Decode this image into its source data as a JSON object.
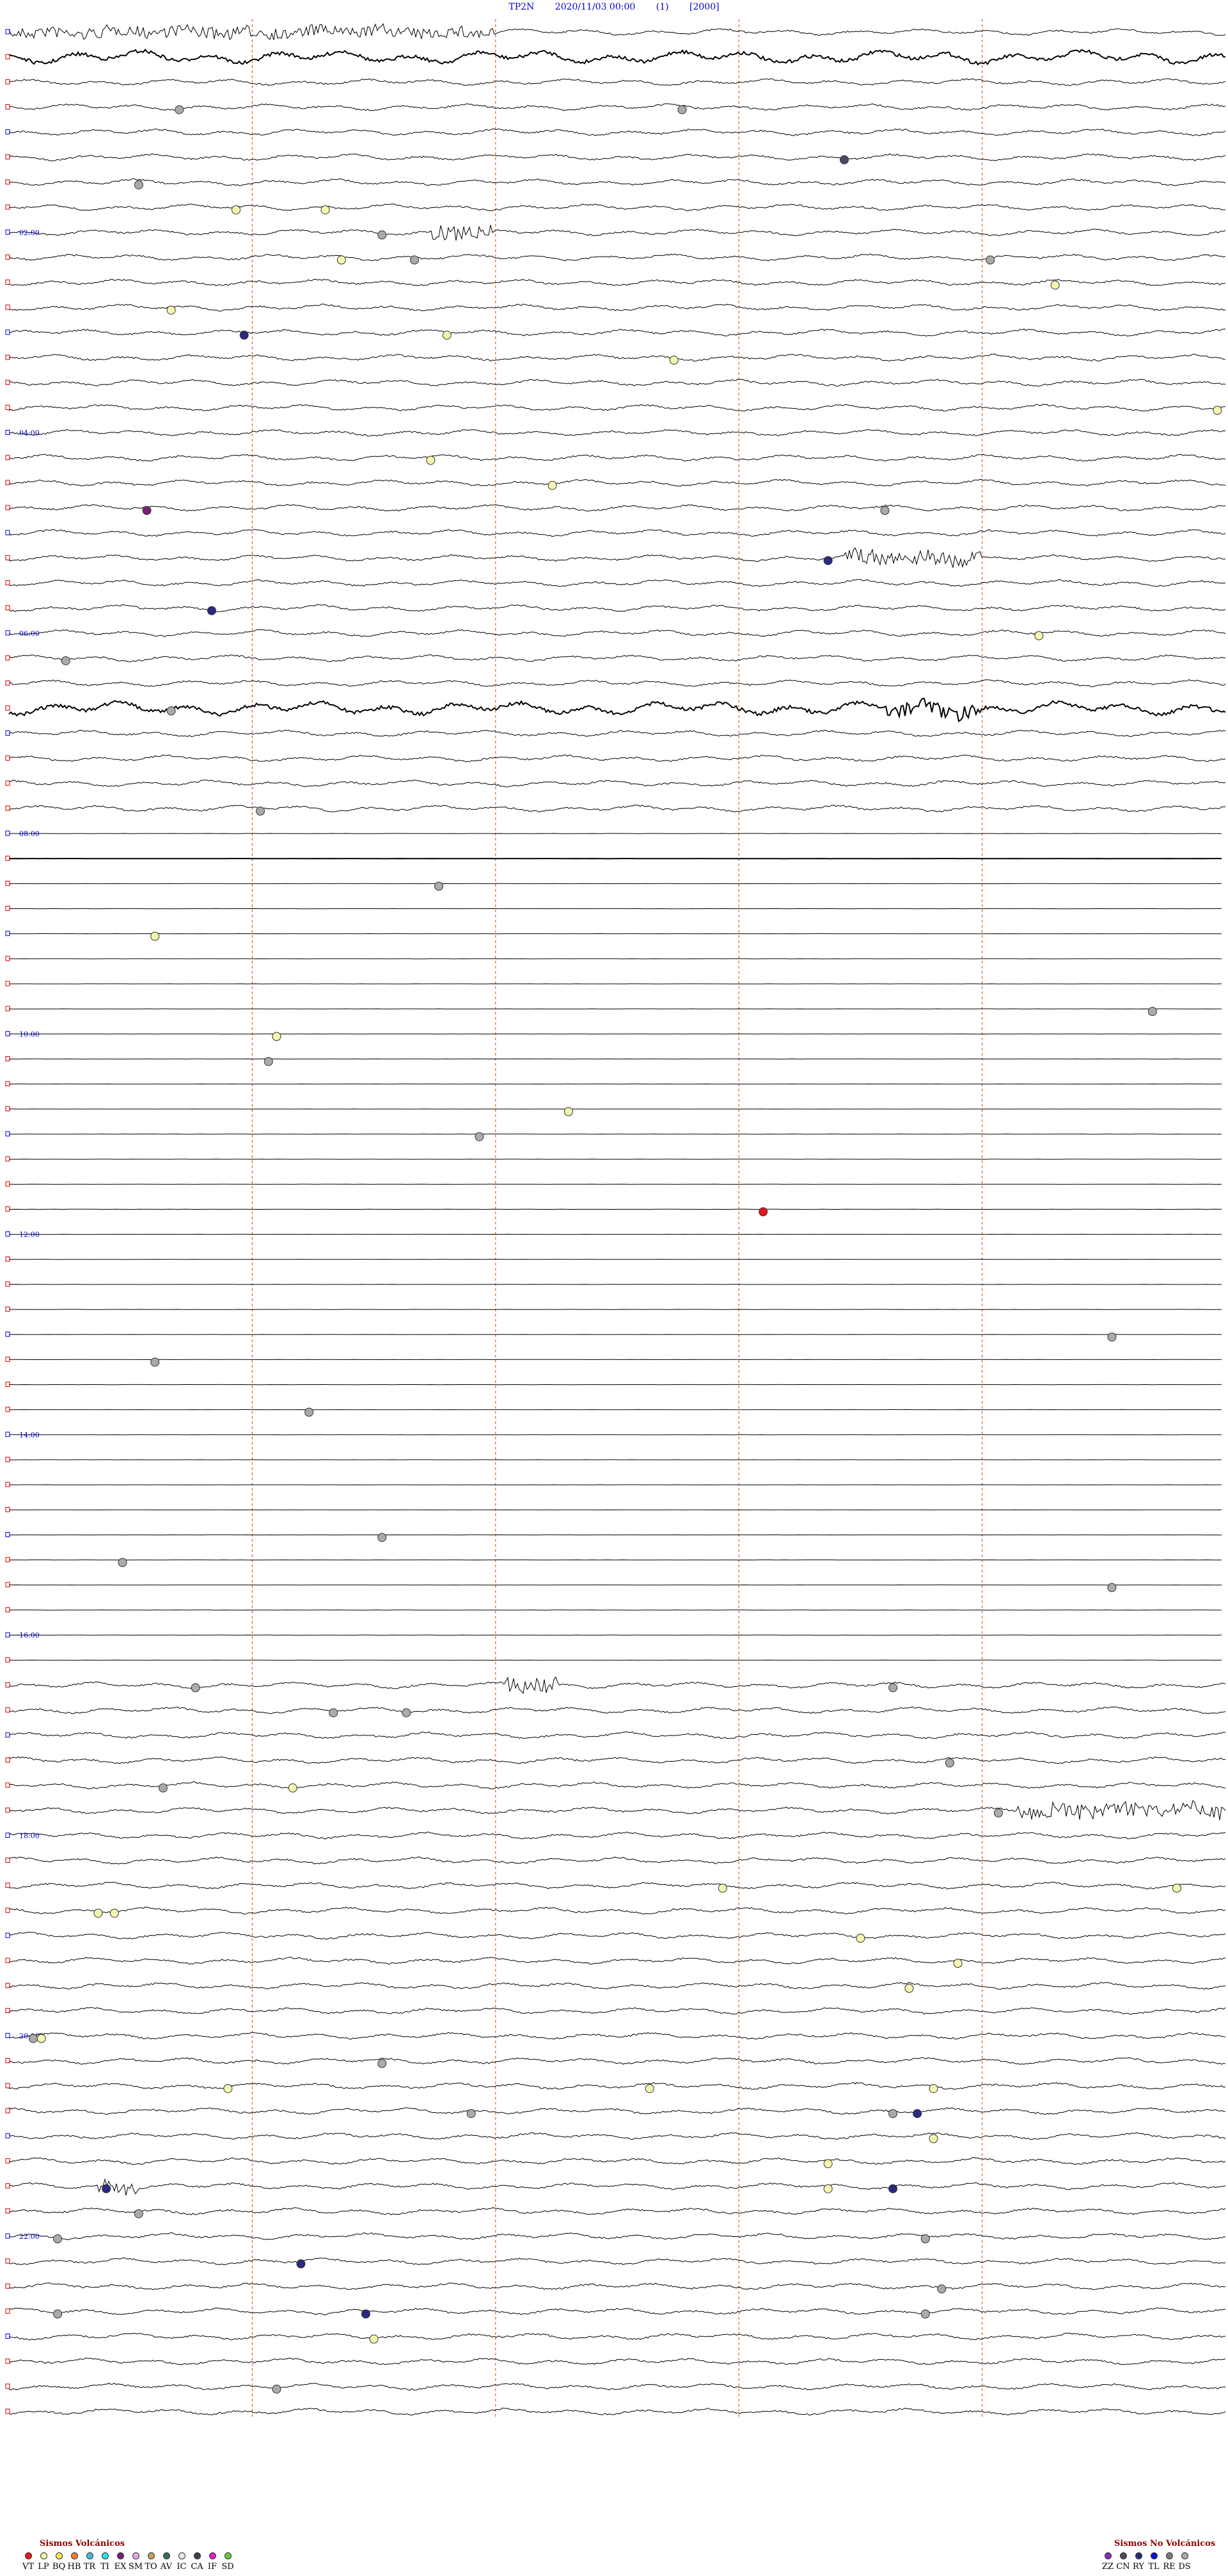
{
  "header": {
    "station": "TP2N",
    "datetime": "2020/11/03 00:00",
    "channel": "(1)",
    "scale": "[2000]"
  },
  "chart_data": {
    "type": "helicorder",
    "rows": 96,
    "row_minutes": 15,
    "time_labels": [
      "02:00",
      "04:00",
      "06:00",
      "08:00",
      "10:00",
      "12:00",
      "14:00",
      "16:00",
      "18:00",
      "20:00",
      "22:00"
    ],
    "minute_marks": [
      3,
      6,
      9,
      12
    ],
    "noisy_row_ranges": [
      [
        0,
        32
      ],
      [
        66,
        96
      ]
    ],
    "high_amplitude_rows": [
      1,
      27,
      33
    ],
    "bursts": [
      {
        "row": 0,
        "from_min": 0.0,
        "to_min": 6.0,
        "type": "dense"
      },
      {
        "row": 8,
        "from_min": 5.2,
        "to_min": 6.0,
        "type": "event"
      },
      {
        "row": 21,
        "from_min": 10.3,
        "to_min": 12.0,
        "type": "event"
      },
      {
        "row": 27,
        "from_min": 10.8,
        "to_min": 12.0,
        "type": "event"
      },
      {
        "row": 66,
        "from_min": 6.1,
        "to_min": 6.8,
        "type": "event"
      },
      {
        "row": 71,
        "from_min": 12.4,
        "to_min": 15.0,
        "type": "event"
      },
      {
        "row": 86,
        "from_min": 1.1,
        "to_min": 1.6,
        "type": "event"
      }
    ],
    "events": [
      {
        "row": 3,
        "minute": 2.1,
        "type": "DS"
      },
      {
        "row": 3,
        "minute": 8.3,
        "type": "DS"
      },
      {
        "row": 5,
        "minute": 10.3,
        "type": "CN"
      },
      {
        "row": 6,
        "minute": 1.6,
        "type": "DS"
      },
      {
        "row": 7,
        "minute": 2.8,
        "type": "LP"
      },
      {
        "row": 7,
        "minute": 3.9,
        "type": "LP"
      },
      {
        "row": 8,
        "minute": 4.6,
        "type": "DS"
      },
      {
        "row": 9,
        "minute": 5.0,
        "type": "DS"
      },
      {
        "row": 9,
        "minute": 12.1,
        "type": "DS"
      },
      {
        "row": 9,
        "minute": 4.1,
        "type": "LP"
      },
      {
        "row": 10,
        "minute": 12.9,
        "type": "LP"
      },
      {
        "row": 11,
        "minute": 2.0,
        "type": "LP"
      },
      {
        "row": 12,
        "minute": 5.4,
        "type": "LP"
      },
      {
        "row": 12,
        "minute": 2.9,
        "type": "RY"
      },
      {
        "row": 13,
        "minute": 8.2,
        "type": "LP"
      },
      {
        "row": 15,
        "minute": 14.9,
        "type": "LP"
      },
      {
        "row": 17,
        "minute": 5.2,
        "type": "LP"
      },
      {
        "row": 18,
        "minute": 6.7,
        "type": "LP"
      },
      {
        "row": 19,
        "minute": 1.7,
        "type": "EX"
      },
      {
        "row": 19,
        "minute": 10.8,
        "type": "DS"
      },
      {
        "row": 21,
        "minute": 10.1,
        "type": "RY"
      },
      {
        "row": 23,
        "minute": 2.5,
        "type": "RY"
      },
      {
        "row": 24,
        "minute": 12.7,
        "type": "LP"
      },
      {
        "row": 25,
        "minute": 0.7,
        "type": "DS"
      },
      {
        "row": 27,
        "minute": 2.0,
        "type": "DS"
      },
      {
        "row": 31,
        "minute": 3.1,
        "type": "DS"
      },
      {
        "row": 34,
        "minute": 5.3,
        "type": "DS"
      },
      {
        "row": 36,
        "minute": 1.8,
        "type": "LP"
      },
      {
        "row": 39,
        "minute": 14.1,
        "type": "DS"
      },
      {
        "row": 40,
        "minute": 3.3,
        "type": "LP"
      },
      {
        "row": 41,
        "minute": 3.2,
        "type": "DS"
      },
      {
        "row": 43,
        "minute": 6.9,
        "type": "LP"
      },
      {
        "row": 44,
        "minute": 5.8,
        "type": "DS"
      },
      {
        "row": 47,
        "minute": 9.3,
        "type": "VT"
      },
      {
        "row": 52,
        "minute": 13.6,
        "type": "DS"
      },
      {
        "row": 53,
        "minute": 1.8,
        "type": "DS"
      },
      {
        "row": 55,
        "minute": 3.7,
        "type": "DS"
      },
      {
        "row": 60,
        "minute": 4.6,
        "type": "DS"
      },
      {
        "row": 61,
        "minute": 1.4,
        "type": "DS"
      },
      {
        "row": 62,
        "minute": 13.6,
        "type": "DS"
      },
      {
        "row": 66,
        "minute": 2.3,
        "type": "DS"
      },
      {
        "row": 66,
        "minute": 10.9,
        "type": "DS"
      },
      {
        "row": 67,
        "minute": 4.0,
        "type": "DS"
      },
      {
        "row": 67,
        "minute": 4.9,
        "type": "DS"
      },
      {
        "row": 69,
        "minute": 11.6,
        "type": "DS"
      },
      {
        "row": 70,
        "minute": 1.9,
        "type": "DS"
      },
      {
        "row": 70,
        "minute": 3.5,
        "type": "LP"
      },
      {
        "row": 71,
        "minute": 12.2,
        "type": "DS"
      },
      {
        "row": 74,
        "minute": 8.8,
        "type": "LP"
      },
      {
        "row": 74,
        "minute": 14.4,
        "type": "LP"
      },
      {
        "row": 75,
        "minute": 1.1,
        "type": "LP"
      },
      {
        "row": 75,
        "minute": 1.3,
        "type": "LP"
      },
      {
        "row": 76,
        "minute": 10.5,
        "type": "LP"
      },
      {
        "row": 77,
        "minute": 11.7,
        "type": "LP"
      },
      {
        "row": 78,
        "minute": 11.1,
        "type": "LP"
      },
      {
        "row": 80,
        "minute": 0.3,
        "type": "DS"
      },
      {
        "row": 80,
        "minute": 0.4,
        "type": "LP"
      },
      {
        "row": 81,
        "minute": 4.6,
        "type": "DS"
      },
      {
        "row": 82,
        "minute": 11.4,
        "type": "LP"
      },
      {
        "row": 82,
        "minute": 2.7,
        "type": "LP"
      },
      {
        "row": 82,
        "minute": 7.9,
        "type": "LP"
      },
      {
        "row": 83,
        "minute": 11.2,
        "type": "RY"
      },
      {
        "row": 83,
        "minute": 10.9,
        "type": "DS"
      },
      {
        "row": 83,
        "minute": 5.7,
        "type": "DS"
      },
      {
        "row": 84,
        "minute": 11.4,
        "type": "LP"
      },
      {
        "row": 85,
        "minute": 10.1,
        "type": "LP"
      },
      {
        "row": 86,
        "minute": 1.2,
        "type": "RY"
      },
      {
        "row": 86,
        "minute": 10.1,
        "type": "LP"
      },
      {
        "row": 86,
        "minute": 10.9,
        "type": "RY"
      },
      {
        "row": 87,
        "minute": 1.6,
        "type": "DS"
      },
      {
        "row": 88,
        "minute": 0.6,
        "type": "DS"
      },
      {
        "row": 88,
        "minute": 11.3,
        "type": "DS"
      },
      {
        "row": 89,
        "minute": 3.6,
        "type": "RY"
      },
      {
        "row": 90,
        "minute": 11.5,
        "type": "DS"
      },
      {
        "row": 91,
        "minute": 0.6,
        "type": "DS"
      },
      {
        "row": 91,
        "minute": 4.4,
        "type": "RY"
      },
      {
        "row": 91,
        "minute": 11.3,
        "type": "DS"
      },
      {
        "row": 92,
        "minute": 4.5,
        "type": "LP"
      },
      {
        "row": 94,
        "minute": 3.3,
        "type": "DS"
      }
    ]
  },
  "legend": {
    "volcanic_title": "Sismos Volcánicos",
    "non_volcanic_title": "Sismos No Volcánicos",
    "volcanic": [
      {
        "code": "VT",
        "color": "#e8141a"
      },
      {
        "code": "LP",
        "color": "#f5f5b0"
      },
      {
        "code": "BQ",
        "color": "#f2e64a"
      },
      {
        "code": "HB",
        "color": "#f07f2a"
      },
      {
        "code": "TR",
        "color": "#47b8e0"
      },
      {
        "code": "TI",
        "color": "#2ee0e0"
      },
      {
        "code": "EX",
        "color": "#7a1f7a"
      },
      {
        "code": "SM",
        "color": "#e8a6e8"
      },
      {
        "code": "TO",
        "color": "#c8a060"
      },
      {
        "code": "AV",
        "color": "#3a6e58"
      },
      {
        "code": "IC",
        "color": "#e8e8e8"
      },
      {
        "code": "CA",
        "color": "#404050"
      },
      {
        "code": "IF",
        "color": "#e01cc8"
      },
      {
        "code": "SD",
        "color": "#6cc83c"
      }
    ],
    "non_volcanic": [
      {
        "code": "ZZ",
        "color": "#8a2bb8"
      },
      {
        "code": "CN",
        "color": "#4a4a5a"
      },
      {
        "code": "RY",
        "color": "#2a2a80"
      },
      {
        "code": "TL",
        "color": "#1212d8"
      },
      {
        "code": "RE",
        "color": "#7a7a7a"
      },
      {
        "code": "DS",
        "color": "#aaaaaa"
      }
    ]
  },
  "colors": {
    "trace": "#000000",
    "minute_line": "#e06020",
    "hour_label": "#0000cc",
    "row_tick": "#cc0000",
    "lp_dot": "#f5f5b0",
    "ds_dot": "#888888",
    "ry_dot": "#0000cc",
    "vt_dot": "#e01010",
    "ex_dot": "#9b30d0",
    "cn_dot": "#555555"
  }
}
